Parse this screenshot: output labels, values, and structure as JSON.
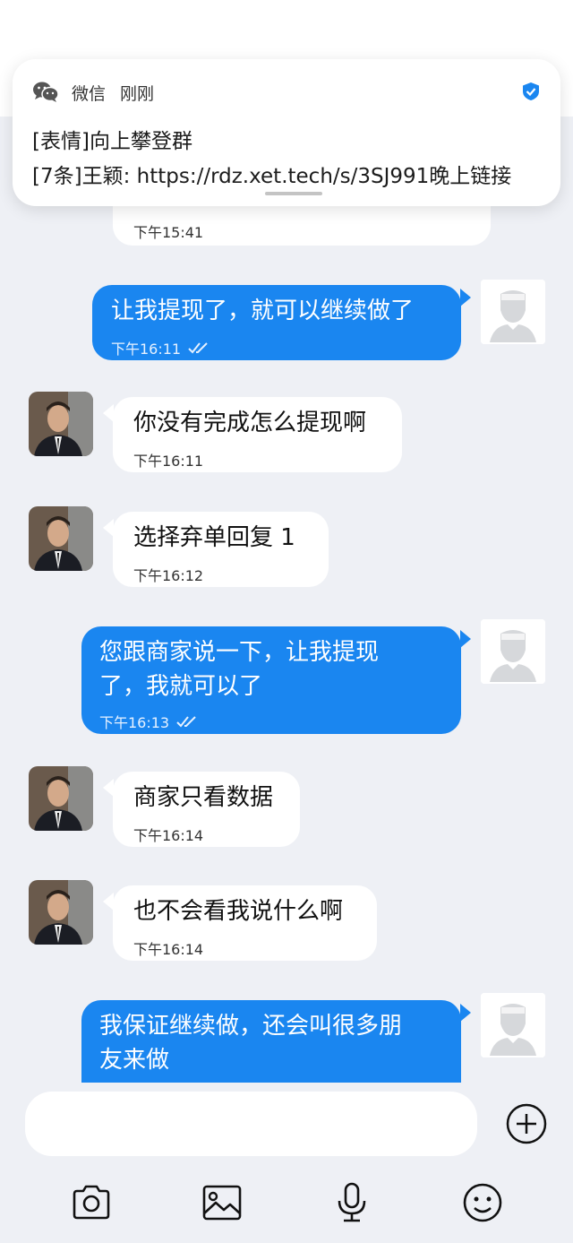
{
  "header": {
    "title": ""
  },
  "notification": {
    "app_name": "微信",
    "time": "刚刚",
    "line1": "[表情]向上攀登群",
    "line2": "[7条]王颖: https://rdz.xet.tech/s/3SJ991晚上链接"
  },
  "messages": [
    {
      "dir": "in",
      "text": "",
      "time": "下午15:41"
    },
    {
      "dir": "out",
      "text": "让我提现了，就可以继续做了",
      "time": "下午16:11"
    },
    {
      "dir": "in",
      "text": "你没有完成怎么提现啊",
      "time": "下午16:11"
    },
    {
      "dir": "in",
      "text": "选择弃单回复 1",
      "time": "下午16:12"
    },
    {
      "dir": "out",
      "line1": "您跟商家说一下，让我提现",
      "line2": "了，我就可以了",
      "time": "下午16:13"
    },
    {
      "dir": "in",
      "text": "商家只看数据",
      "time": "下午16:14"
    },
    {
      "dir": "in",
      "text": "也不会看我说什么啊",
      "time": "下午16:14"
    },
    {
      "dir": "out",
      "line1": "我保证继续做，还会叫很多朋",
      "line2": "友来做"
    }
  ],
  "input": {
    "placeholder": ""
  },
  "colors": {
    "outgoing": "#1a86f0",
    "incoming": "#ffffff",
    "background": "#eef0f5"
  },
  "toolbar": [
    "camera-icon",
    "image-icon",
    "microphone-icon",
    "emoji-icon"
  ]
}
